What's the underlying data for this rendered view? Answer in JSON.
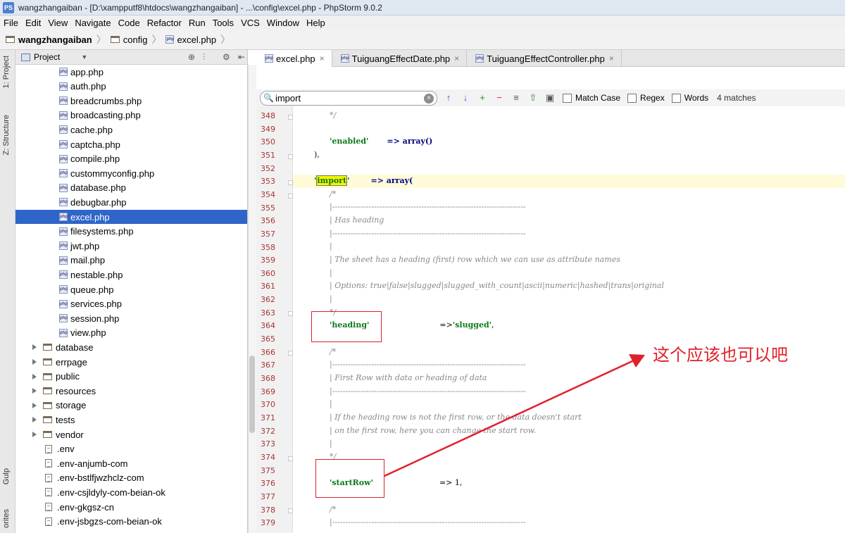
{
  "window": {
    "title": "wangzhangaiban - [D:\\xampputf8\\htdocs\\wangzhangaiban] - ...\\config\\excel.php - PhpStorm 9.0.2",
    "app_badge": "PS"
  },
  "menu": [
    "File",
    "Edit",
    "View",
    "Navigate",
    "Code",
    "Refactor",
    "Run",
    "Tools",
    "VCS",
    "Window",
    "Help"
  ],
  "breadcrumb": [
    "wangzhangaiban",
    "config",
    "excel.php"
  ],
  "left_strip": {
    "project_tab": "1: Project",
    "structure_tab": "Z: Structure",
    "gulp_tab": "Gulp",
    "favorites_tab": "orites"
  },
  "project_panel": {
    "title": "Project",
    "config_files": [
      "app.php",
      "auth.php",
      "breadcrumbs.php",
      "broadcasting.php",
      "cache.php",
      "captcha.php",
      "compile.php",
      "custommyconfig.php",
      "database.php",
      "debugbar.php",
      "excel.php",
      "filesystems.php",
      "jwt.php",
      "mail.php",
      "nestable.php",
      "queue.php",
      "services.php",
      "session.php",
      "view.php"
    ],
    "selected": "excel.php",
    "folders": [
      "database",
      "errpage",
      "public",
      "resources",
      "storage",
      "tests",
      "vendor"
    ],
    "env_files": [
      ".env",
      ".env-anjumb-com",
      ".env-bstlfjwzhclz-com",
      ".env-csjldyly-com-beian-ok",
      ".env-gkgsz-cn",
      ".env-jsbgzs-com-beian-ok"
    ]
  },
  "tabs": [
    {
      "label": "excel.php",
      "active": true
    },
    {
      "label": "TuiguangEffectDate.php",
      "active": false
    },
    {
      "label": "TuiguangEffectController.php",
      "active": false
    }
  ],
  "search": {
    "value": "import",
    "match_case": "Match Case",
    "regex": "Regex",
    "words": "Words",
    "matches": "4 matches"
  },
  "code": {
    "line_numbers": [
      "348",
      "349",
      "350",
      "351",
      "352",
      "353",
      "354",
      "355",
      "356",
      "357",
      "358",
      "359",
      "360",
      "361",
      "362",
      "363",
      "364",
      "365",
      "366",
      "367",
      "368",
      "369",
      "370",
      "371",
      "372",
      "373",
      "374",
      "375",
      "376",
      "377",
      "378",
      "379"
    ],
    "l348": "*/",
    "l350_key": "'enabled'",
    "l350_rest": "=> array()",
    "l351": "),",
    "l353_q1": "'",
    "l353_key": "import",
    "l353_q2": "'",
    "l353_rest": "=> array(",
    "l354": "/*",
    "l355": "|--------------------------------------------------------------------------",
    "l356": "| Has heading",
    "l357": "|--------------------------------------------------------------------------",
    "l358": "|",
    "l359": "| The sheet has a heading (first) row which we can use as attribute names",
    "l360": "|",
    "l361": "| Options: true|false|slugged|slugged_with_count|ascii|numeric|hashed|trans|original",
    "l362": "|",
    "l363": "*/",
    "l364_key": "'heading'",
    "l364_op": "=>",
    "l364_val": "'slugged'",
    "l364_end": ",",
    "l366": "/*",
    "l367": "|--------------------------------------------------------------------------",
    "l368": "| First Row with data or heading of data",
    "l369": "|--------------------------------------------------------------------------",
    "l370": "|",
    "l371": "| If the heading row is not the first row, or the data doesn't start",
    "l372": "| on the first row, here you can change the start row.",
    "l373": "|",
    "l374": "*/",
    "l376_key": "'startRow'",
    "l376_rest": "=> 1,",
    "l378": "/*",
    "l379": "|--------------------------------------------------------------------------"
  },
  "annotation": {
    "text": "这个应该也可以吧",
    "color": "#e0202a"
  }
}
